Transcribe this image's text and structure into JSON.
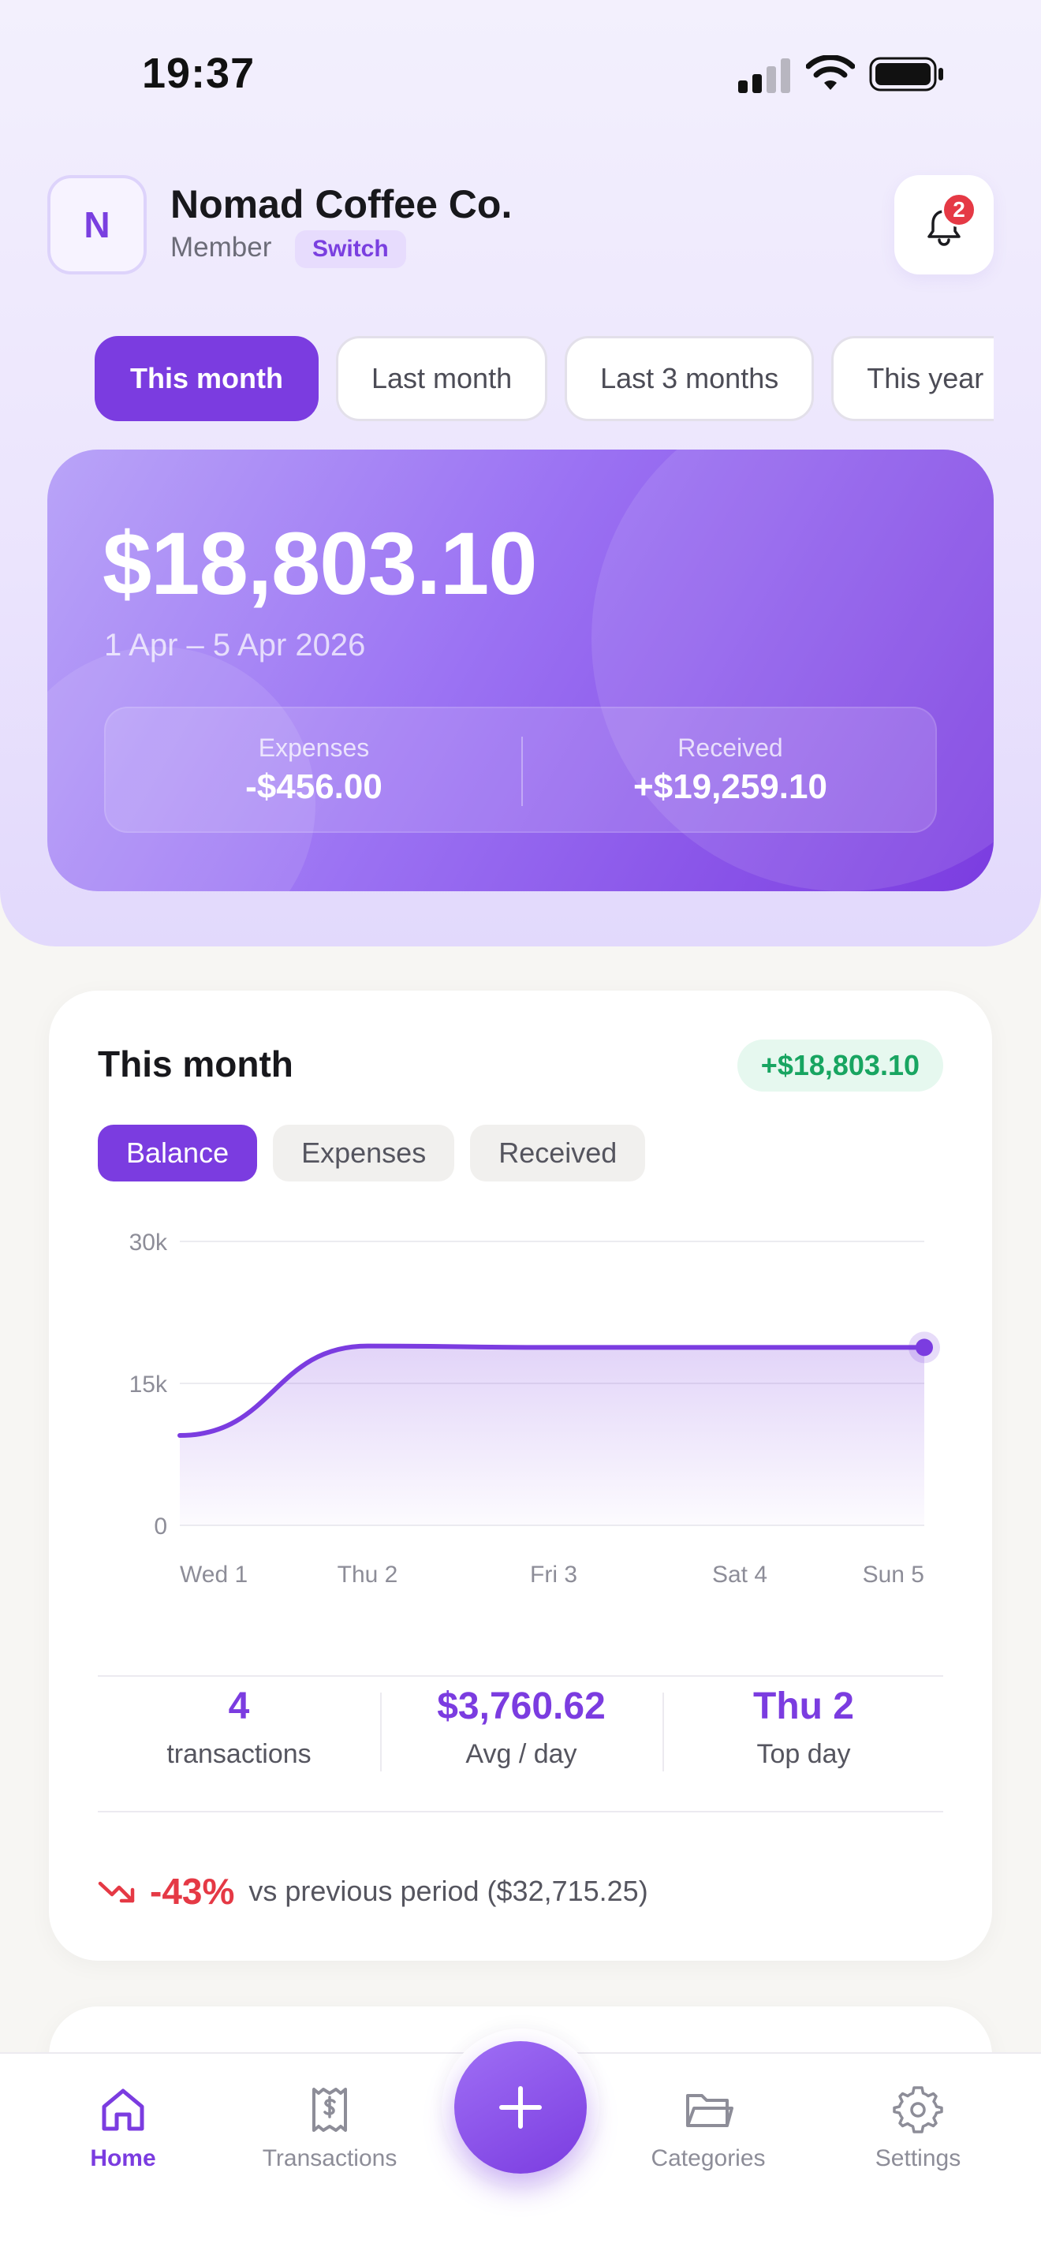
{
  "status_bar": {
    "time": "19:37"
  },
  "business": {
    "initial": "N",
    "name": "Nomad Coffee Co.",
    "role": "Member",
    "switch_label": "Switch",
    "notification_count": "2"
  },
  "period_filters": [
    "This month",
    "Last month",
    "Last 3 months",
    "This year"
  ],
  "balance_card": {
    "amount": "$18,803.10",
    "range": "1 Apr – 5 Apr 2026",
    "expenses_label": "Expenses",
    "expenses_value": "-$456.00",
    "received_label": "Received",
    "received_value": "+$19,259.10"
  },
  "chart_card": {
    "title": "This month",
    "delta": "+$18,803.10",
    "tabs": [
      "Balance",
      "Expenses",
      "Received"
    ],
    "active_tab": "Balance",
    "stats": [
      {
        "value": "4",
        "label": "transactions"
      },
      {
        "value": "$3,760.62",
        "label": "Avg / day"
      },
      {
        "value": "Thu 2",
        "label": "Top day"
      }
    ],
    "comparison": {
      "pct": "-43%",
      "text": "vs previous period ($32,715.25)"
    }
  },
  "chart_data": {
    "type": "area",
    "x": [
      "Wed 1",
      "Thu 2",
      "Fri 3",
      "Sat 4",
      "Sun 5"
    ],
    "values": [
      9500,
      18950,
      18803.1,
      18803.1,
      18803.1
    ],
    "y_ticks": [
      "0",
      "15k",
      "30k"
    ],
    "ylim": [
      0,
      30000
    ],
    "grid": true,
    "line_color": "#7b3ce0"
  },
  "tab_bar": {
    "items": [
      {
        "label": "Home",
        "icon": "home-icon",
        "active": true
      },
      {
        "label": "Transactions",
        "icon": "receipt-icon",
        "active": false
      },
      {
        "label": "Categories",
        "icon": "folder-icon",
        "active": false
      },
      {
        "label": "Settings",
        "icon": "gear-icon",
        "active": false
      }
    ]
  },
  "colors": {
    "accent": "#7b3ce0",
    "positive": "#18a561",
    "negative": "#e53945"
  }
}
